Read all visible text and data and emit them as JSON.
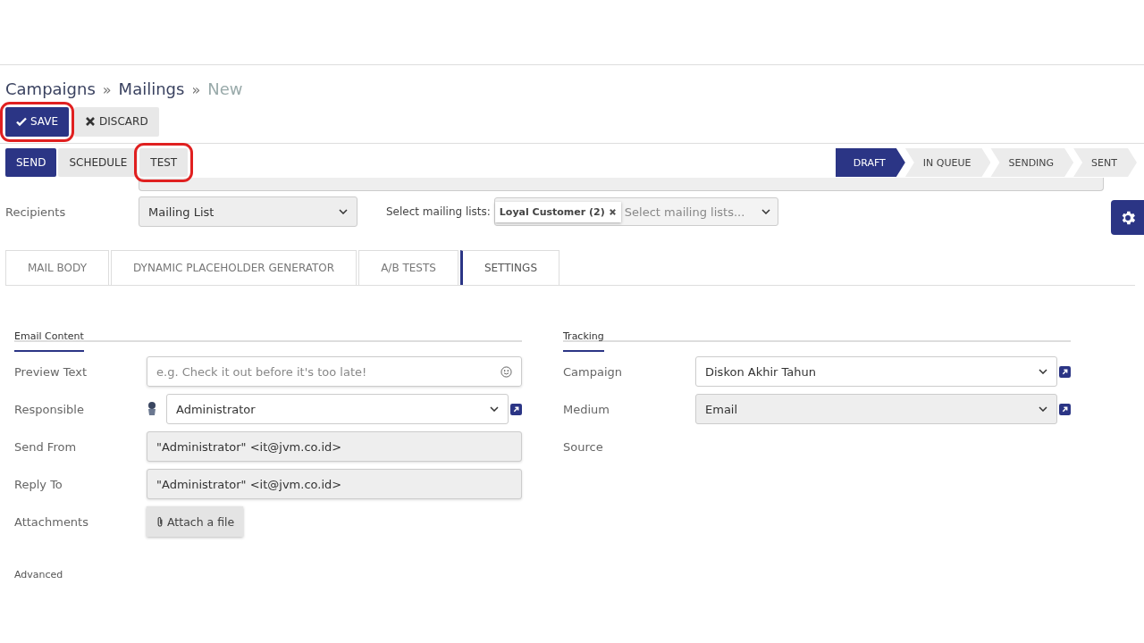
{
  "breadcrumb": [
    {
      "label": "Campaigns",
      "current": false
    },
    {
      "label": "Mailings",
      "current": false
    },
    {
      "label": "New",
      "current": true
    }
  ],
  "separator": "»",
  "control_buttons": [
    {
      "label": "SAVE",
      "kind": "primary",
      "highlighted": true
    },
    {
      "label": "DISCARD",
      "kind": "secondary",
      "highlighted": false
    }
  ],
  "action_buttons": [
    {
      "label": "SEND",
      "kind": "primary",
      "highlighted": false
    },
    {
      "label": "SCHEDULE",
      "kind": "secondary",
      "highlighted": false
    },
    {
      "label": "TEST",
      "kind": "secondary",
      "highlighted": true
    }
  ],
  "status_steps": [
    {
      "label": "DRAFT",
      "selected": true
    },
    {
      "label": "IN QUEUE",
      "selected": false
    },
    {
      "label": "SENDING",
      "selected": false
    },
    {
      "label": "SENT",
      "selected": false
    }
  ],
  "recipients": {
    "label": "Recipients",
    "value": "Mailing List",
    "lists_label": "Select mailing lists:",
    "tags": [
      "Loyal Customer (2)"
    ],
    "placeholder": "Select mailing lists..."
  },
  "tabs": [
    {
      "label": "MAIL BODY",
      "selected": false
    },
    {
      "label": "DYNAMIC PLACEHOLDER GENERATOR",
      "selected": false
    },
    {
      "label": "A/B TESTS",
      "selected": false
    },
    {
      "label": "SETTINGS",
      "selected": true
    }
  ],
  "email_content": {
    "title": "Email Content",
    "fields": [
      {
        "label": "Preview Text",
        "kind": "text",
        "placeholder": "e.g. Check it out before it's too late!"
      },
      {
        "label": "Responsible",
        "kind": "user-select",
        "value": "Administrator"
      },
      {
        "label": "Send From",
        "kind": "readonly",
        "value": "\"Administrator\" <it@jvm.co.id>"
      },
      {
        "label": "Reply To",
        "kind": "readonly",
        "value": "\"Administrator\" <it@jvm.co.id>"
      },
      {
        "label": "Attachments",
        "kind": "attach",
        "value": "Attach a file"
      }
    ]
  },
  "tracking": {
    "title": "Tracking",
    "fields": [
      {
        "label": "Campaign",
        "kind": "select",
        "value": "Diskon Akhir Tahun"
      },
      {
        "label": "Medium",
        "kind": "select-grey",
        "value": "Email"
      },
      {
        "label": "Source",
        "kind": "empty"
      }
    ]
  },
  "advanced": {
    "title": "Advanced"
  }
}
